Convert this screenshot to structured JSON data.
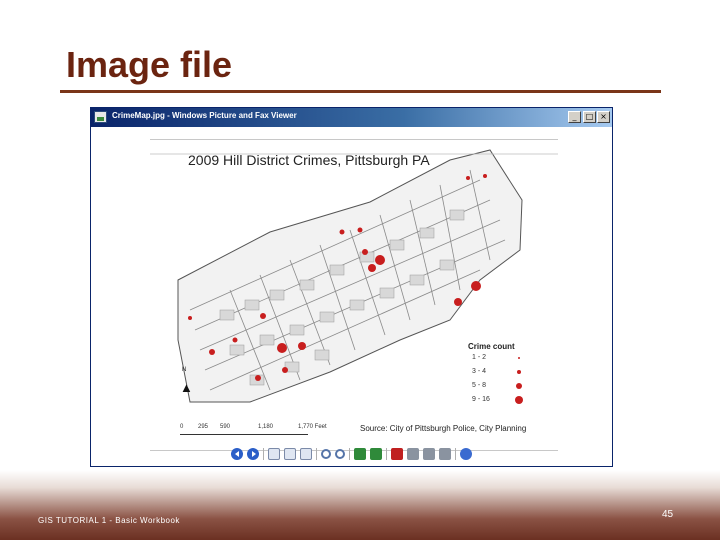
{
  "slide": {
    "title": "Image file",
    "footer_text": "GIS TUTORIAL 1 - Basic Workbook",
    "page_number": "45"
  },
  "window": {
    "title": "CrimeMap.jpg - Windows Picture and Fax Viewer",
    "buttons": {
      "minimize": "_",
      "maximize": "□",
      "close": "×"
    }
  },
  "map": {
    "title": "2009 Hill District Crimes, Pittsburgh PA",
    "legend": {
      "title": "Crime count",
      "items": [
        {
          "label": "1 - 2"
        },
        {
          "label": "3 - 4"
        },
        {
          "label": "5 - 8"
        },
        {
          "label": "9 - 16"
        }
      ]
    },
    "north_label": "N",
    "scale_labels": [
      "0",
      "295",
      "590",
      "1,180",
      "1,770 Feet"
    ],
    "source": "Source: City of Pittsburgh Police, City Planning"
  },
  "toolbar": {
    "buttons": [
      "previous-image-icon",
      "next-image-icon",
      "best-fit-icon",
      "actual-size-icon",
      "slideshow-icon",
      "zoom-in-icon",
      "zoom-out-icon",
      "rotate-clockwise-icon",
      "rotate-counterclockwise-icon",
      "delete-icon",
      "print-icon",
      "save-icon",
      "edit-icon",
      "help-icon"
    ]
  },
  "colors": {
    "title": "#6b2410",
    "window_title_bar": "#0a246a",
    "crime_dot": "#c81e1e",
    "footer": "#6b3022"
  }
}
